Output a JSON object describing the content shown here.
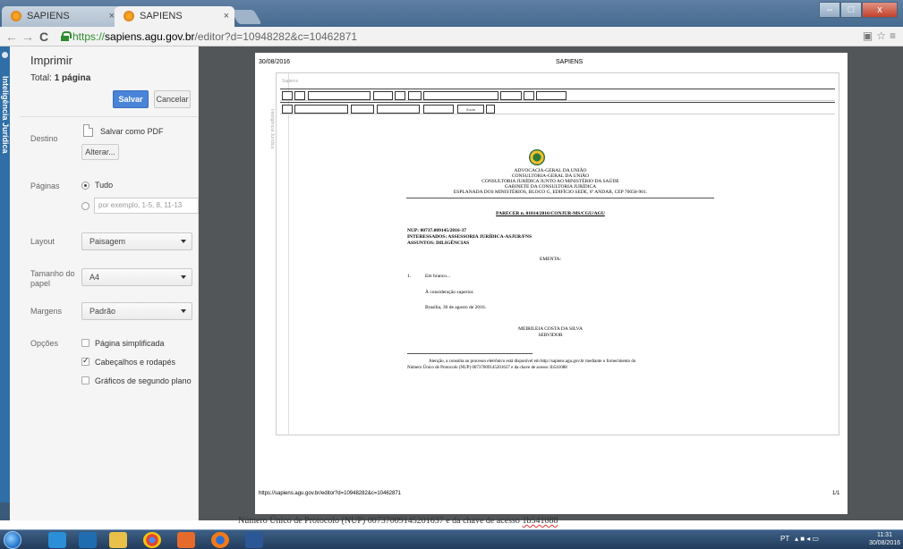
{
  "browser": {
    "tabs": [
      {
        "label": "SAPIENS",
        "active": false
      },
      {
        "label": "SAPIENS",
        "active": true
      }
    ],
    "url": {
      "scheme": "https://",
      "host": "sapiens.agu.gov.br",
      "path": "/editor?d=10948282&c=10462871"
    },
    "window_buttons": {
      "minimize": "–",
      "maximize": "□",
      "close": "x"
    }
  },
  "sidetab": {
    "label": "Inteligência Jurídica"
  },
  "print": {
    "title": "Imprimir",
    "total_label": "Total:",
    "total_value": "1 página",
    "save_label": "Salvar",
    "cancel_label": "Cancelar",
    "destination": {
      "label": "Destino",
      "value": "Salvar como PDF",
      "change_label": "Alterar..."
    },
    "pages": {
      "label": "Páginas",
      "all_label": "Tudo",
      "custom_placeholder": "por exemplo, 1-5, 8, 11-13",
      "selected": "all"
    },
    "layout": {
      "label": "Layout",
      "value": "Paisagem"
    },
    "paper": {
      "label": "Tamanho do papel",
      "value": "A4"
    },
    "margins": {
      "label": "Margens",
      "value": "Padrão"
    },
    "options": {
      "label": "Opções",
      "items": [
        {
          "label": "Página simplificada",
          "checked": false
        },
        {
          "label": "Cabeçalhos e rodapés",
          "checked": true
        },
        {
          "label": "Gráficos de segundo plano",
          "checked": false
        }
      ]
    }
  },
  "preview": {
    "header_date": "30/08/2016",
    "header_title": "SAPIENS",
    "footer_url": "https://sapiens.agu.gov.br/editor?d=10948282&c=10462871",
    "footer_page": "1/1",
    "inner_label": "Sapiens",
    "vertical_label": "Inteligência Jurídica",
    "zoom_label": "Zoom",
    "document": {
      "org_lines": [
        "ADVOCACIA-GERAL DA UNIÃO",
        "CONSULTORIA-GERAL DA UNIÃO",
        "CONSULTORIA JURÍDICA JUNTO AO MINISTÉRIO DA SAÚDE",
        "GABINETE DA CONSULTORIA JURÍDICA",
        "ESPLANADA DOS MINISTÉRIOS, BLOCO G, EDIFÍCIO SEDE, 6º ANDAR, CEP 70058-901."
      ],
      "parecer": "PARECER n. 01014/2016/CONJUR-MS/CGU/AGU",
      "nup": "NUP: 00737.009145/2016-37",
      "interessados": "INTERESSADOS: ASSESSORIA JURÍDICA-ASJUR/FNS",
      "assuntos": "ASSUNTOS: DILIGÊNCIAS",
      "ementa": "EMENTA:",
      "item_number": "1.",
      "item_text": "Em branco...",
      "consideracao": "À consideração superior.",
      "local_data": "Brasília, 30 de agosto de 2016.",
      "signer_name": "MEIRILEIA COSTA DA SILVA",
      "signer_role": "SERVIDOR",
      "notice_line1": "Atenção, a consulta ao processo eletrônico está disponível em http://sapiens.agu.gov.br mediante o fornecimento do",
      "notice_line2": "Número Único de Protocolo (NUP) 00737009145201637 e da chave de acesso 1b541088"
    }
  },
  "background_text": {
    "prefix": "Número Único de Protocolo (NUP) 00737009145201637 e da chave de acesso ",
    "key": "1b541088"
  },
  "taskbar": {
    "language": "PT",
    "time": "11:31",
    "date": "30/08/2016"
  }
}
